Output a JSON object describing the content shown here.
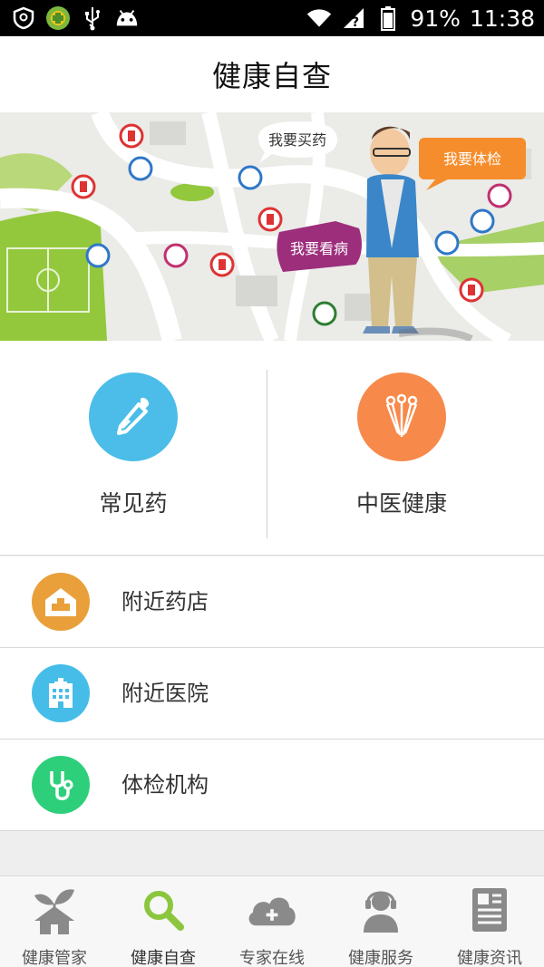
{
  "status_bar": {
    "battery": "91%",
    "time": "11:38",
    "icons": [
      "shield-icon",
      "app-badge-icon",
      "usb-icon",
      "android-icon",
      "wifi-icon",
      "signal-icon",
      "battery-icon"
    ]
  },
  "header": {
    "title": "健康自查"
  },
  "banner": {
    "bubbles": [
      "我要买药",
      "我要体检",
      "我要看病"
    ]
  },
  "quick_actions": [
    {
      "label": "常见药",
      "icon": "dropper-icon",
      "color": "#4bbde8"
    },
    {
      "label": "中医健康",
      "icon": "acupuncture-needles-icon",
      "color": "#f7894a"
    }
  ],
  "list": [
    {
      "label": "附近药店",
      "icon": "pharmacy-icon",
      "color": "#e9a03b"
    },
    {
      "label": "附近医院",
      "icon": "hospital-icon",
      "color": "#46bde8"
    },
    {
      "label": "体检机构",
      "icon": "stethoscope-icon",
      "color": "#2ecf7a"
    }
  ],
  "tabs": [
    {
      "label": "健康管家",
      "icon": "house-plant-icon",
      "active": false
    },
    {
      "label": "健康自查",
      "icon": "magnifier-icon",
      "active": true
    },
    {
      "label": "专家在线",
      "icon": "cloud-plus-icon",
      "active": false
    },
    {
      "label": "健康服务",
      "icon": "support-agent-icon",
      "active": false
    },
    {
      "label": "健康资讯",
      "icon": "newspaper-icon",
      "active": false
    }
  ],
  "colors": {
    "accent_green": "#8cc63e",
    "tab_icon_gray": "#8a8a8a"
  }
}
